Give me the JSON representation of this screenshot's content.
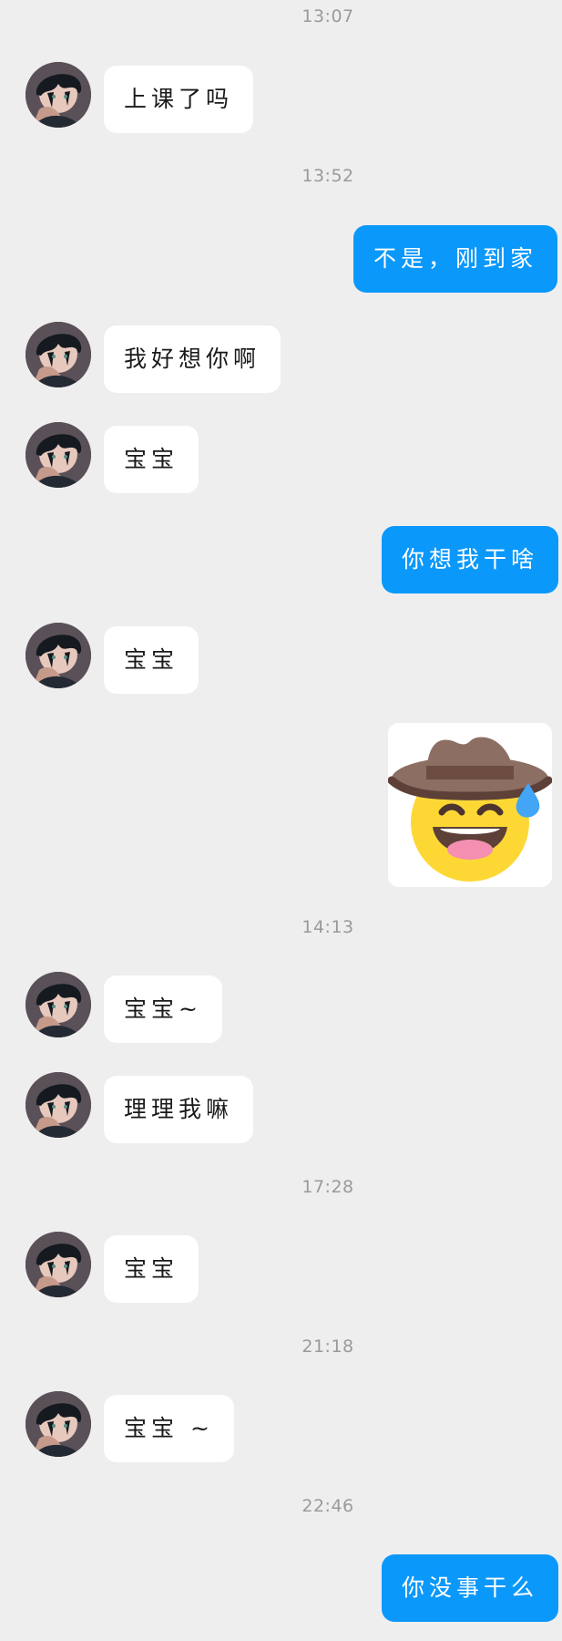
{
  "timestamps": {
    "t1": "13:07",
    "t2": "13:52",
    "t3": "14:13",
    "t4": "17:28",
    "t5": "21:18",
    "t6": "22:46"
  },
  "messages": {
    "m1": "上课了吗",
    "m2": "不是，刚到家",
    "m3": "我好想你啊",
    "m4": "宝宝",
    "m5": "你想我干啥",
    "m6": "宝宝",
    "m8": "宝宝~",
    "m9": "理理我嘛",
    "m10": "宝宝",
    "m11": "宝宝 ~",
    "m12": "你没事干么"
  },
  "sticker": {
    "icon": "cowboy-sweat-smile-icon",
    "colors": {
      "hat": "#8d6e63",
      "face": "#fdd835",
      "sweat": "#42a5f5"
    }
  },
  "theme": {
    "background": "#eeeeee",
    "incoming_bubble": "#ffffff",
    "outgoing_bubble": "#0b98fb",
    "timestamp_text": "#9a9a9a"
  }
}
